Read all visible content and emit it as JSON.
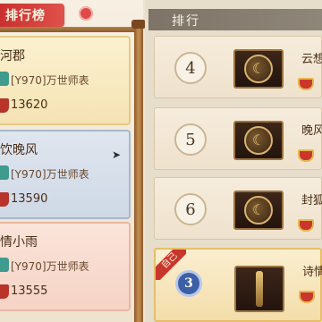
{
  "left_panel": {
    "title": "排行榜",
    "players": [
      {
        "name": "河郡",
        "guild": "[Y970]万世师表",
        "score": "13620"
      },
      {
        "name": "饮晚风",
        "guild": "[Y970]万世师表",
        "score": "13590"
      },
      {
        "name": "情小雨",
        "guild": "[Y970]万世师表",
        "score": "13555"
      }
    ],
    "guild_tag": "表"
  },
  "right_panel": {
    "header": "排行",
    "rows": [
      {
        "rank": "4",
        "name": "云想"
      },
      {
        "rank": "5",
        "name": "晚风"
      },
      {
        "rank": "6",
        "name": "封狐"
      }
    ],
    "self": {
      "rank": "3",
      "name": "诗情",
      "ribbon": "自己"
    }
  },
  "colors": {
    "title_red": "#c92f2f",
    "self_highlight": "#f3ddaa",
    "guild_tag": "#3f9b8e"
  },
  "icons": {
    "close": "close-icon",
    "trophy": "trophy-icon",
    "avatar_emblem": "moon-emblem-icon",
    "sword": "sword-icon",
    "cursor": "mouse-cursor-icon"
  }
}
